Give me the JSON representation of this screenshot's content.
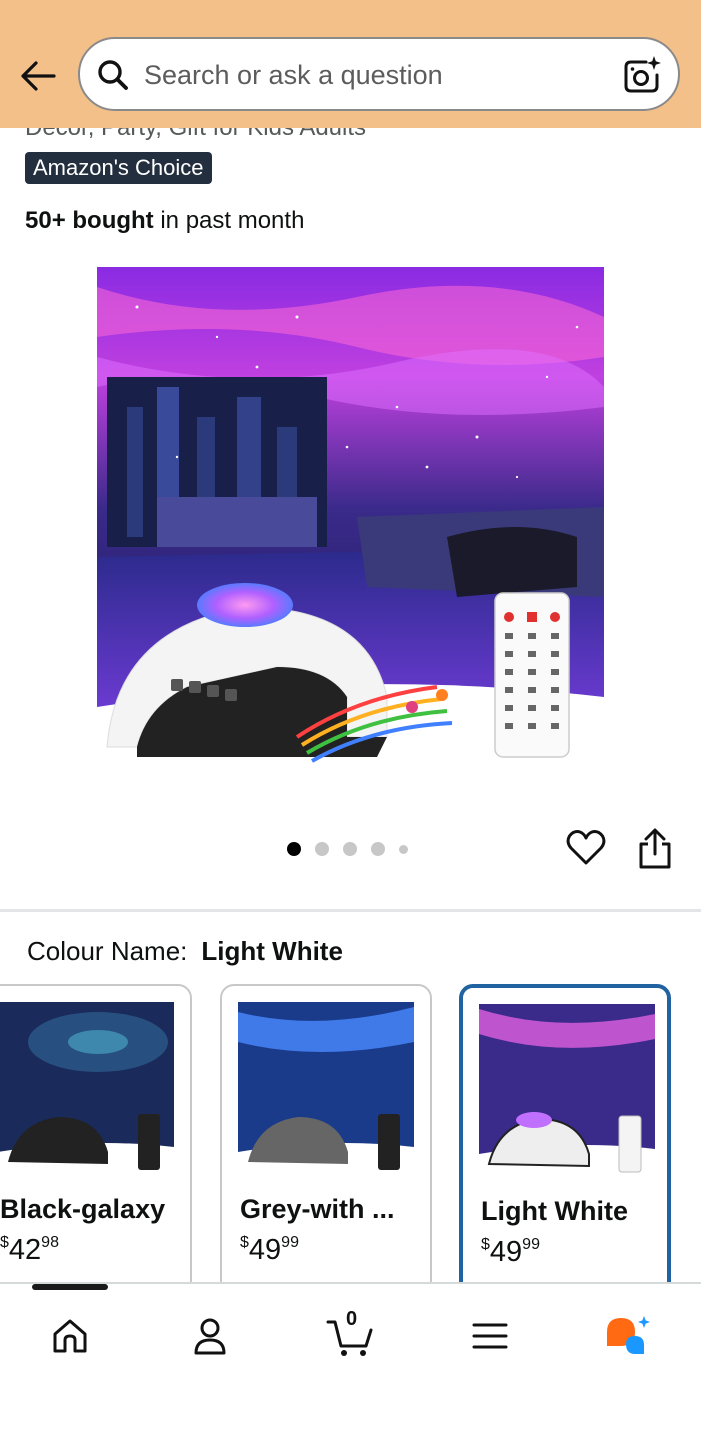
{
  "header": {
    "search_placeholder": "Search or ask a question",
    "back_icon": "back-arrow-icon",
    "search_icon": "search-icon",
    "camera_icon": "camera-sparkle-icon"
  },
  "product": {
    "title_fragment": "Decor, Party, Gift for Kids Adults",
    "badge": "Amazon's Choice",
    "bought_bold": "50+ bought",
    "bought_rest": " in past month",
    "image_count": 5,
    "active_image": 1
  },
  "colour": {
    "label": "Colour Name:",
    "value": "Light White"
  },
  "swatches": [
    {
      "name": "Black-galaxy",
      "price_whole": "42",
      "price_fraction": "98",
      "currency": "$",
      "selected": false
    },
    {
      "name": "Grey-with ...",
      "price_whole": "49",
      "price_fraction": "99",
      "currency": "$",
      "selected": false
    },
    {
      "name": "Light White",
      "price_whole": "49",
      "price_fraction": "99",
      "currency": "$",
      "selected": true
    }
  ],
  "nav": {
    "items": [
      "home-icon",
      "account-icon",
      "cart-icon",
      "menu-icon",
      "rufus-ai-icon"
    ],
    "cart_count": "0"
  },
  "colors": {
    "header_bg": "#f3c08a",
    "badge_bg": "#232f3e",
    "selected_border": "#2162a1",
    "ai_orange": "#ff6a13",
    "ai_blue": "#1a98ff"
  }
}
